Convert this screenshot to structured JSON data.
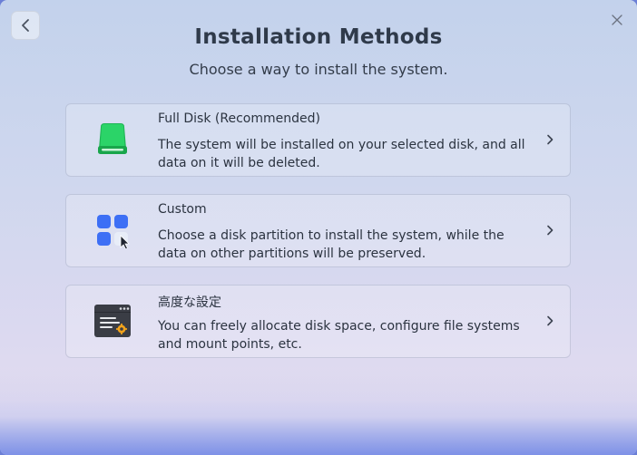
{
  "header": {
    "title": "Installation Methods",
    "subtitle": "Choose a way to install the system."
  },
  "nav": {
    "back_icon": "chevron-left-icon",
    "close_icon": "close-icon"
  },
  "options": [
    {
      "title": "Full Disk (Recommended)",
      "description": "The system will be installed on your selected disk, and all data on it will be deleted.",
      "icon": "disk-icon"
    },
    {
      "title": "Custom",
      "description": "Choose a disk partition to install the system, while the data on other partitions will be preserved.",
      "icon": "custom-partition-icon"
    },
    {
      "title": "高度な設定",
      "description": "You can freely allocate disk space, configure file systems and mount points, etc.",
      "icon": "advanced-settings-icon"
    }
  ],
  "colors": {
    "disk_green": "#22c35a",
    "tile_blue": "#3d6ff5",
    "terminal_dark": "#3a3d45",
    "gear_orange": "#f2a31b"
  }
}
